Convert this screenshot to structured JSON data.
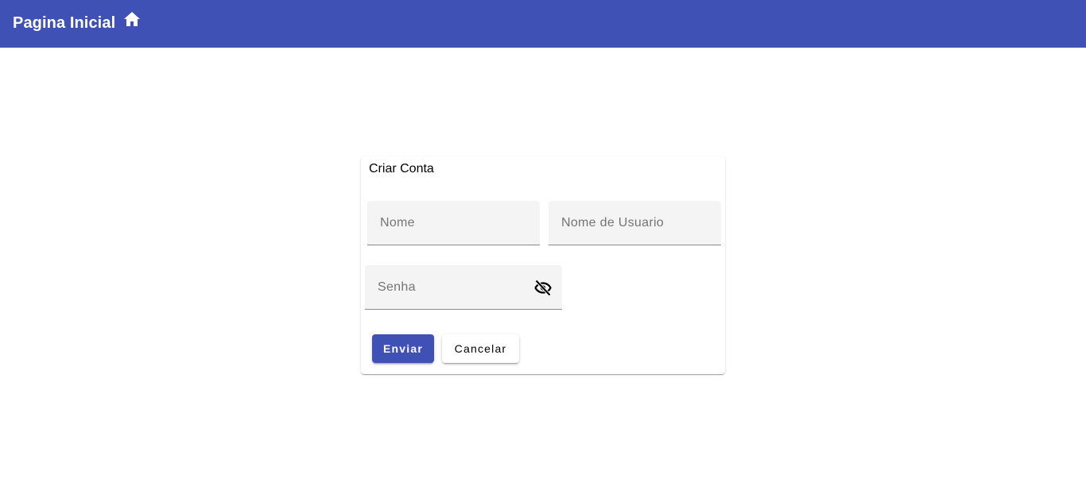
{
  "header": {
    "title": "Pagina Inicial",
    "home_icon": "home-icon",
    "background_color": "#3f51b5"
  },
  "form": {
    "title": "Criar Conta",
    "fields": {
      "nome": {
        "placeholder": "Nome",
        "value": ""
      },
      "usuario": {
        "placeholder": "Nome de Usuario",
        "value": ""
      },
      "senha": {
        "placeholder": "Senha",
        "value": "",
        "visibility_icon": "visibility-off-icon"
      }
    },
    "buttons": {
      "submit_label": "Enviar",
      "cancel_label": "Cancelar"
    },
    "accent_color": "#3f51b5"
  }
}
